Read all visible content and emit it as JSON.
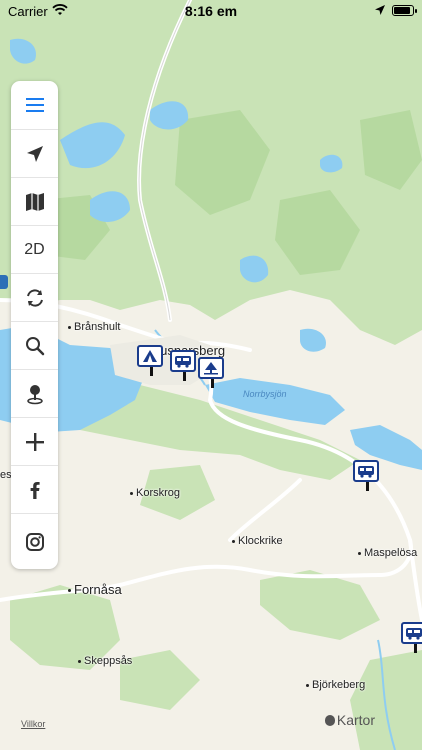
{
  "status_bar": {
    "carrier": "Carrier",
    "time": "8:16 em",
    "battery_level": 0.9
  },
  "toolbar": {
    "two_d_label": "2D"
  },
  "places": {
    "branshult": "Brånshult",
    "ljusnarsberg": "Ljusnarsberg",
    "korskrog": "Korskrog",
    "klockrike": "Klockrike",
    "maspelosa": "Maspelösa",
    "fornasa": "Fornåsa",
    "skeppsas": "Skeppsås",
    "bjorkeberg": "Björkeberg",
    "vest": "est"
  },
  "water": {
    "norrbysjon": "Norrbysjön"
  },
  "legal": {
    "terms": "Villkor"
  },
  "attribution": {
    "maps": "Kartor"
  },
  "colors": {
    "land": "#f3f1e8",
    "forest": "#c9e3b6",
    "water": "#8ecdf1",
    "road": "#ffffff",
    "poi_border": "#1a3c8c",
    "accent": "#1a7cf0"
  }
}
